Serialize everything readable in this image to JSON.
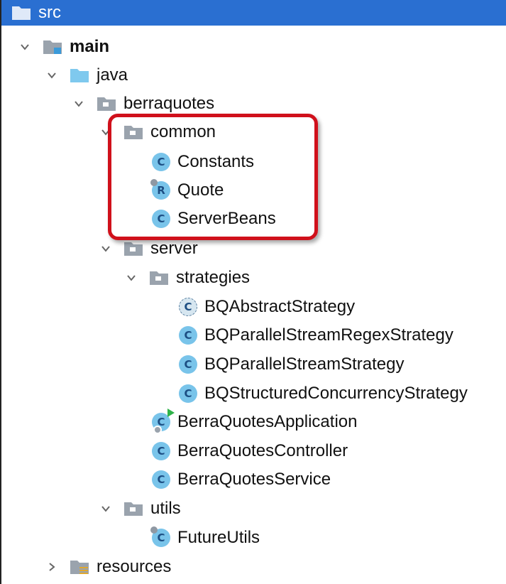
{
  "tree": {
    "root": {
      "label": "src"
    },
    "main": {
      "label": "main"
    },
    "java": {
      "label": "java"
    },
    "berraquotes": {
      "label": "berraquotes"
    },
    "common": {
      "label": "common"
    },
    "constants": {
      "label": "Constants",
      "badge": "C"
    },
    "quote": {
      "label": "Quote",
      "badge": "R"
    },
    "serverbeans": {
      "label": "ServerBeans",
      "badge": "C"
    },
    "server": {
      "label": "server"
    },
    "strategies": {
      "label": "strategies"
    },
    "abstract_strategy": {
      "label": "BQAbstractStrategy",
      "badge": "C"
    },
    "parallel_regex": {
      "label": "BQParallelStreamRegexStrategy",
      "badge": "C"
    },
    "parallel_stream": {
      "label": "BQParallelStreamStrategy",
      "badge": "C"
    },
    "structured_concurrency": {
      "label": "BQStructuredConcurrencyStrategy",
      "badge": "C"
    },
    "application": {
      "label": "BerraQuotesApplication",
      "badge": "C"
    },
    "controller": {
      "label": "BerraQuotesController",
      "badge": "C"
    },
    "service": {
      "label": "BerraQuotesService",
      "badge": "C"
    },
    "utils": {
      "label": "utils"
    },
    "futureutils": {
      "label": "FutureUtils",
      "badge": "C"
    },
    "resources": {
      "label": "resources"
    }
  },
  "colors": {
    "selection": "#2a6fd1",
    "class_badge": "#79c4ea",
    "highlight_box": "#d0101b"
  },
  "icons": [
    "chevron-down-icon",
    "chevron-right-icon",
    "folder-icon",
    "source-folder-icon",
    "package-icon",
    "resources-folder-icon",
    "class-icon",
    "record-icon",
    "abstract-class-icon",
    "spring-boot-app-icon"
  ]
}
